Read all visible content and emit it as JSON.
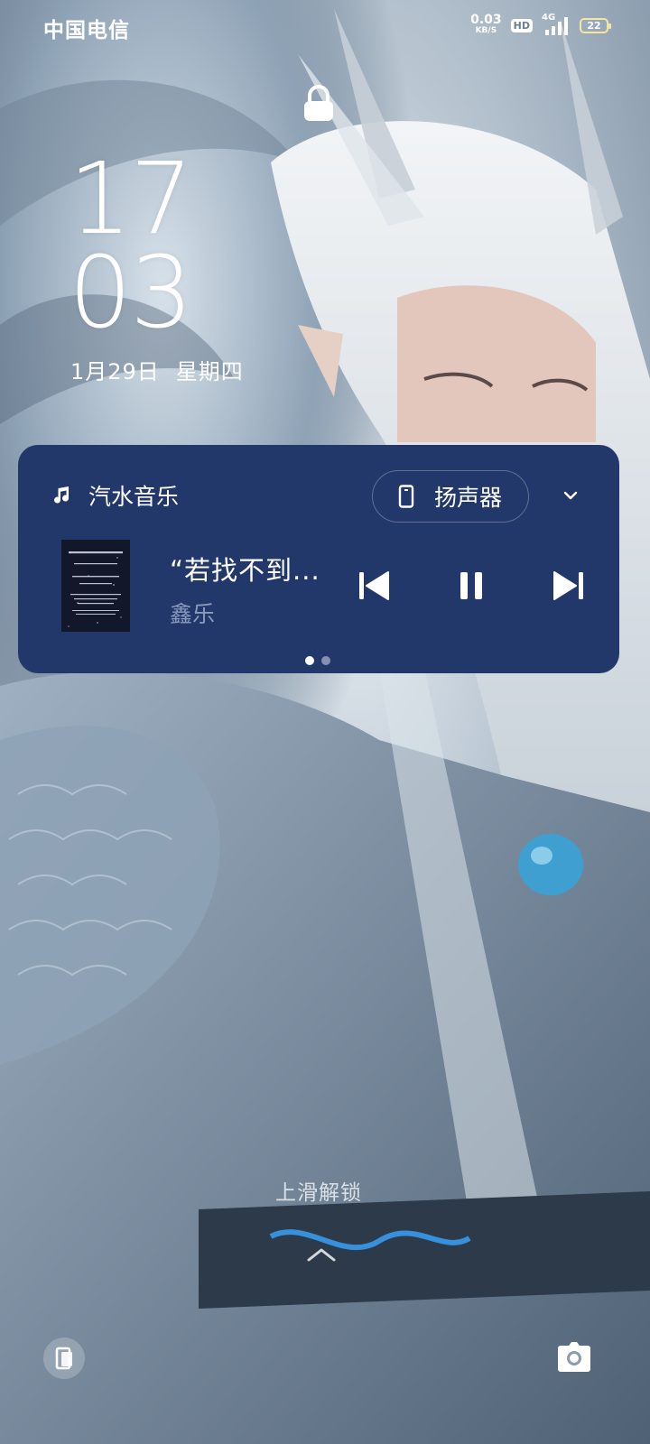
{
  "status_bar": {
    "carrier": "中国电信",
    "net_speed_value": "0.03",
    "net_speed_unit": "KB/S",
    "hd_badge": "HD",
    "network_type": "4G",
    "battery_level": "22"
  },
  "lock_screen": {
    "clock_hour": "17",
    "clock_minute": "03",
    "date": "1月29日",
    "weekday": "星期四",
    "unlock_hint": "上滑解锁"
  },
  "media_card": {
    "app_name": "汽水音乐",
    "output_device": "扬声器",
    "song_title": "“若找不到...",
    "artist": "鑫乐",
    "page_count": 2,
    "active_page": 1,
    "background_color": "#23386a"
  },
  "icons": {
    "lock": "lock-icon",
    "music_app": "music-note-icon",
    "output": "phone-speaker-icon",
    "expand": "chevron-down-icon",
    "prev": "skip-previous-icon",
    "pause": "pause-icon",
    "next": "skip-next-icon",
    "unlock_arrow": "chevron-up-icon",
    "left_shortcut": "device-icon",
    "camera": "camera-icon"
  }
}
